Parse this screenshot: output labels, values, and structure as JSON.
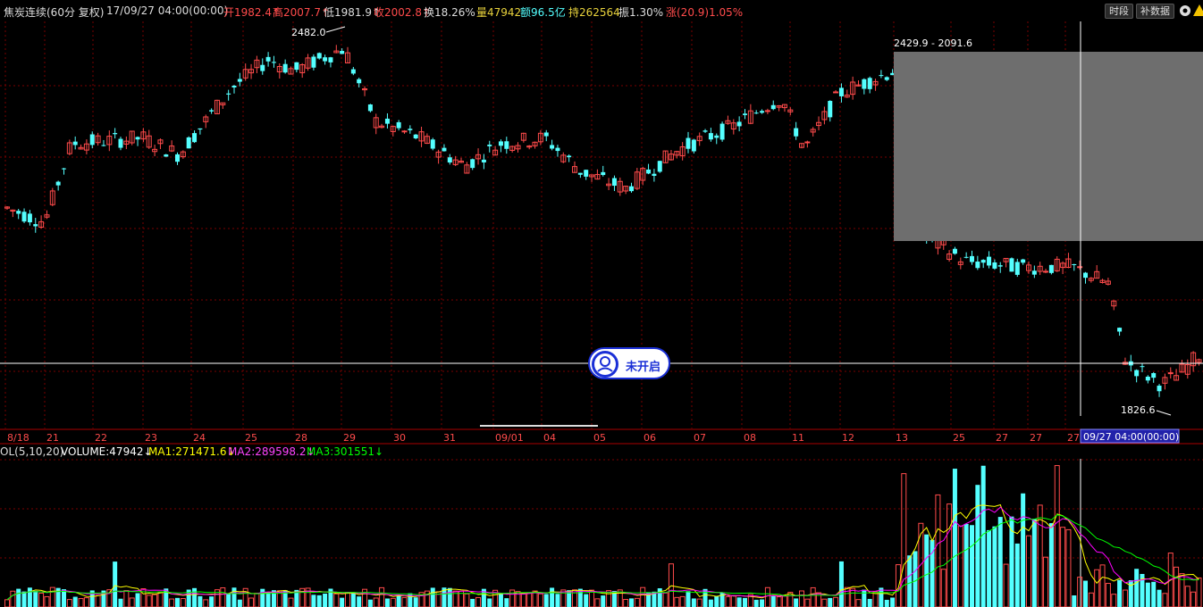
{
  "header": {
    "instrument": "焦炭连续(60分 复权)",
    "datetime": "17/09/27 04:00(00:00)",
    "open": "开1982.4↑",
    "high": "高2007.7↑",
    "low": "低1981.9↑",
    "close": "收2002.8↑",
    "turnover": "换18.26%",
    "volume": "量47942",
    "amount": "额96.5亿",
    "open_interest": "持262564",
    "amplitude": "振1.30%",
    "change": "涨(20.9)1.05%",
    "btn_timeshare": "时段",
    "btn_fill": "补数据"
  },
  "overlay": {
    "range_label": "2429.9 - 2091.6",
    "high_marker": "2482.0",
    "low_marker": "1826.6",
    "crosshair_time": "09/27 04:00(00:00)",
    "badge_label": "未开启"
  },
  "x_axis_labels": [
    "8/18",
    "21",
    "22",
    "23",
    "24",
    "25",
    "28",
    "29",
    "30",
    "31",
    "09/01",
    "04",
    "05",
    "06",
    "07",
    "08",
    "11",
    "12",
    "13",
    "25",
    "27",
    "27",
    "27"
  ],
  "volume_header": {
    "title": "OL(5,10,20)",
    "volume": "VOLUME:47942↓",
    "ma1": "MA1:271471.6↓",
    "ma2": "MA2:289598.2↓",
    "ma3": "MA3:301551↓"
  },
  "colors": {
    "up": "#ff4b4b",
    "down": "#54ffff",
    "grid": "#7a0000",
    "ma1": "#ffff00",
    "ma2": "#ff00ff",
    "ma3": "#00ff00"
  },
  "chart_data": {
    "type": "candlestick",
    "price_range": [
      1790,
      2500
    ],
    "highest": 2482.0,
    "lowest": 1826.6,
    "candles_sample": [
      {
        "o": 2180,
        "h": 2195,
        "l": 2160,
        "c": 2185
      },
      {
        "o": 2300,
        "h": 2320,
        "l": 2280,
        "c": 2310
      },
      {
        "o": 2440,
        "h": 2482,
        "l": 2420,
        "c": 2460
      },
      {
        "o": 2250,
        "h": 2270,
        "l": 2200,
        "c": 2230
      },
      {
        "o": 2400,
        "h": 2430,
        "l": 2380,
        "c": 2420
      },
      {
        "o": 1982.4,
        "h": 2007.7,
        "l": 1981.9,
        "c": 2002.8
      }
    ],
    "volume_last": 47942,
    "ma1": 271471.6,
    "ma2": 289598.2,
    "ma3": 301551
  }
}
